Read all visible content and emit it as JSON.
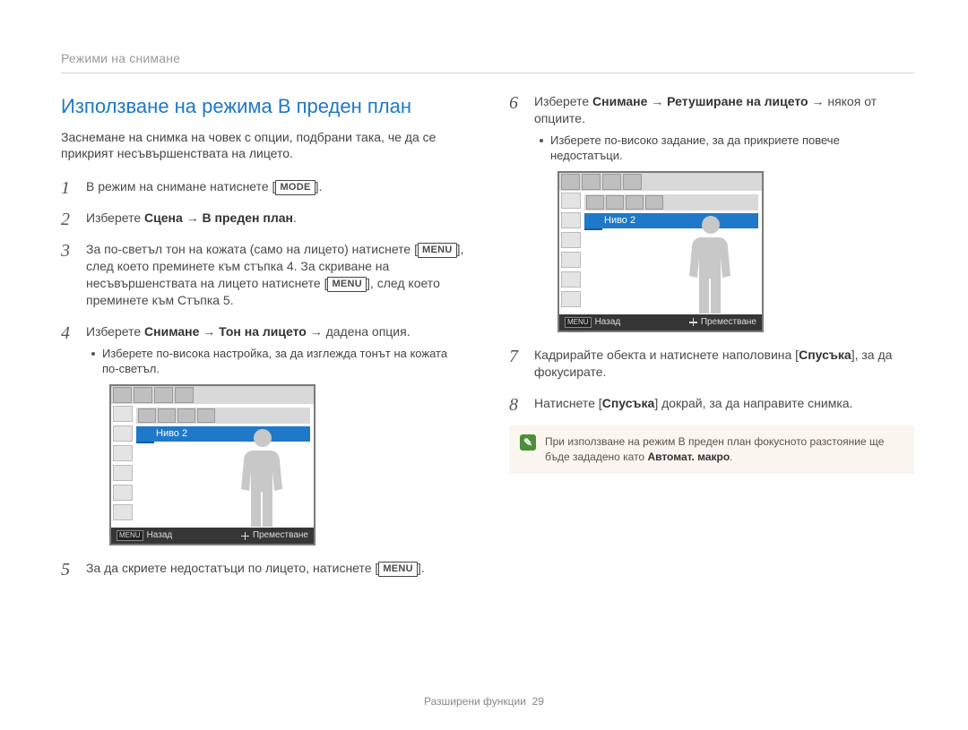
{
  "header": {
    "section": "Режими на снимане"
  },
  "left": {
    "title": "Използване на режима В преден план",
    "intro": "Заснемане на снимка на човек с опции, подбрани така, че да се прикрият несъвършенствата на лицето.",
    "step1_a": "В режим на снимане натиснете [",
    "step1_btn": "MODE",
    "step1_b": "].",
    "step2_a": "Изберете ",
    "step2_b": "Сцена",
    "step2_c": " → ",
    "step2_d": "В преден план",
    "step2_e": ".",
    "step3_a": "За по-светъл тон на кожата (само на лицето) натиснете [",
    "step3_btn1": "MENU",
    "step3_b": "], след което преминете към стъпка 4. За скриване на несъвършенствата на лицето натиснете [",
    "step3_btn2": "MENU",
    "step3_c": "], след което преминете към Стъпка 5.",
    "step4_a": "Изберете ",
    "step4_b": "Снимане",
    "step4_c": " → ",
    "step4_d": "Тон на лицето",
    "step4_e": " → дадена опция.",
    "step4_bullet": "Изберете по-висока настройка, за да изглежда тонът на кожата по-светъл.",
    "step5_a": "За да скриете недостатъци по лицето, натиснете [",
    "step5_btn": "MENU",
    "step5_b": "]."
  },
  "right": {
    "step6_a": "Изберете ",
    "step6_b": "Снимане",
    "step6_c": " → ",
    "step6_d": "Ретуширане на лицето",
    "step6_e": " → някоя от опциите.",
    "step6_bullet": "Изберете по-високо задание, за да прикриете повече недостатъци.",
    "step7_a": "Кадрирайте обекта и натиснете наполовина [",
    "step7_b": "Спусъка",
    "step7_c": "], за да фокусирате.",
    "step8_a": "Натиснете [",
    "step8_b": "Спусъка",
    "step8_c": "] докрай, за да направите снимка.",
    "note_a": "При използване на режим В преден план фокусното разстояние ще бъде зададено като ",
    "note_b": "Автомат. макро",
    "note_c": "."
  },
  "lcd": {
    "level_label": "Ниво 2",
    "back_key": "MENU",
    "back_label": "Назад",
    "move_label": "Преместване"
  },
  "footer": {
    "section": "Разширени функции",
    "page": "29"
  }
}
